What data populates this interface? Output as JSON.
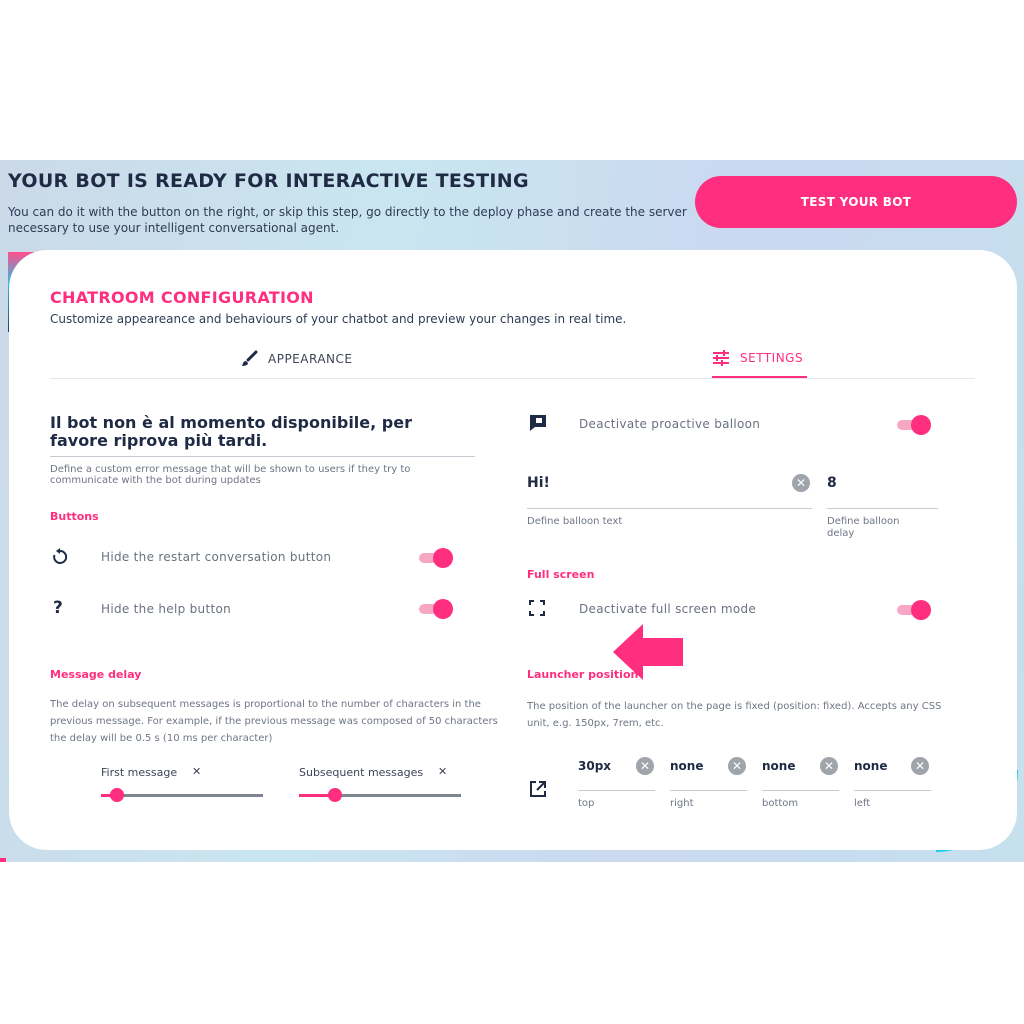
{
  "header": {
    "title": "YOUR BOT IS READY FOR INTERACTIVE TESTING",
    "description": "You can do it with the button on the right, or skip this step, go directly to the deploy phase and create the server necessary to use your intelligent conversational agent.",
    "test_button": "TEST YOUR BOT"
  },
  "card": {
    "title": "CHATROOM CONFIGURATION",
    "subtitle": "Customize appeareance and behaviours of your chatbot and preview your changes in real time."
  },
  "tabs": [
    {
      "label": "APPEARANCE",
      "icon": "brush-icon",
      "active": false
    },
    {
      "label": "SETTINGS",
      "icon": "sliders-icon",
      "active": true
    }
  ],
  "left": {
    "error_message": "Il bot non è al momento disponibile, per favore riprova più tardi.",
    "error_help": "Define a custom error message that will be shown to users if they try to communicate with the bot during updates",
    "buttons_section": "Buttons",
    "restart_label": "Hide the restart conversation button",
    "help_label": "Hide the help button",
    "help_icon": "?",
    "delay_section": "Message delay",
    "delay_desc": "The delay on subsequent messages is proportional to the number of characters in the previous message. For example, if the previous message was composed of 50 characters the delay will be 0.5 s (10 ms per character)",
    "first_message_label": "First message",
    "subsequent_messages_label": "Subsequent messages",
    "first_message_level": 0.1,
    "subsequent_messages_level": 0.22
  },
  "right": {
    "proactive_label": "Deactivate proactive balloon",
    "balloon_text": "Hi!",
    "balloon_text_help": "Define balloon text",
    "balloon_delay": "8",
    "balloon_delay_help": "Define balloon delay",
    "fullscreen_section": "Full screen",
    "fullscreen_label": "Deactivate full screen mode",
    "launcher_section": "Launcher position",
    "launcher_desc": "The position of the launcher on the page is fixed (position: fixed). Accepts any CSS unit, e.g. 150px, 7rem, etc.",
    "positions": [
      {
        "value": "30px",
        "label": "top"
      },
      {
        "value": "none",
        "label": "right"
      },
      {
        "value": "none",
        "label": "bottom"
      },
      {
        "value": "none",
        "label": "left"
      }
    ]
  },
  "colors": {
    "accent": "#ff2e7e",
    "navy": "#1f2a44",
    "cyan": "#1ccaf0"
  },
  "toggles": {
    "restart_hidden": true,
    "help_hidden": true,
    "proactive_deactivated": true,
    "fullscreen_deactivated": true
  }
}
